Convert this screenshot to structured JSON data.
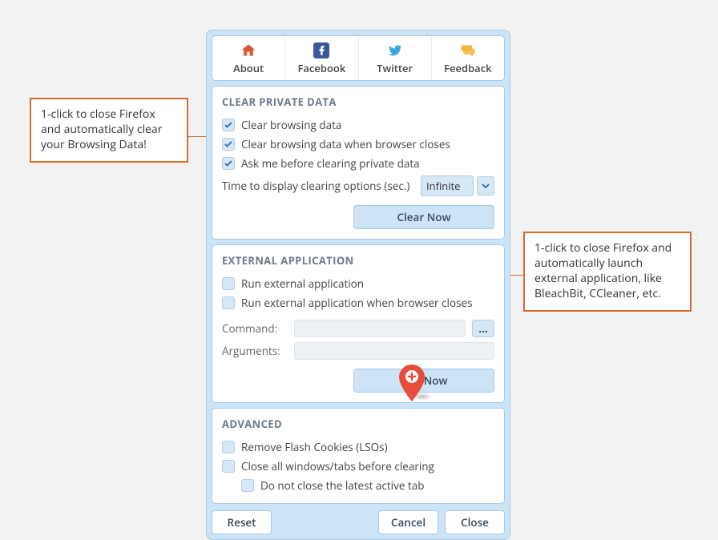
{
  "tabs": {
    "about": "About",
    "facebook": "Facebook",
    "twitter": "Twitter",
    "feedback": "Feedback"
  },
  "section_clear": {
    "title": "CLEAR PRIVATE DATA",
    "opt_clear_browsing": "Clear browsing data",
    "opt_clear_on_close": "Clear browsing data when browser closes",
    "opt_ask_before": "Ask me before clearing private data",
    "opt_time_label": "Time to display clearing options (sec.)",
    "opt_time_value": "Infinite",
    "btn_clear_now": "Clear Now"
  },
  "section_external": {
    "title": "EXTERNAL APPLICATION",
    "opt_run_external": "Run external application",
    "opt_run_external_on_close": "Run external application when browser closes",
    "lbl_command": "Command:",
    "val_command": "",
    "lbl_arguments": "Arguments:",
    "val_arguments": "",
    "btn_browse": "...",
    "btn_run_now": "Run Now"
  },
  "section_advanced": {
    "title": "ADVANCED",
    "opt_remove_lso": "Remove Flash Cookies (LSOs)",
    "opt_close_all": "Close all windows/tabs before clearing",
    "opt_do_not_close_active": "Do not close the latest active tab"
  },
  "footer": {
    "reset": "Reset",
    "cancel": "Cancel",
    "close": "Close"
  },
  "callouts": {
    "left": "1-click to close Firefox and automatically clear your Browsing Data!",
    "right": "1-click to close Firefox and automatically launch external application, like BleachBit, CCleaner, etc."
  }
}
